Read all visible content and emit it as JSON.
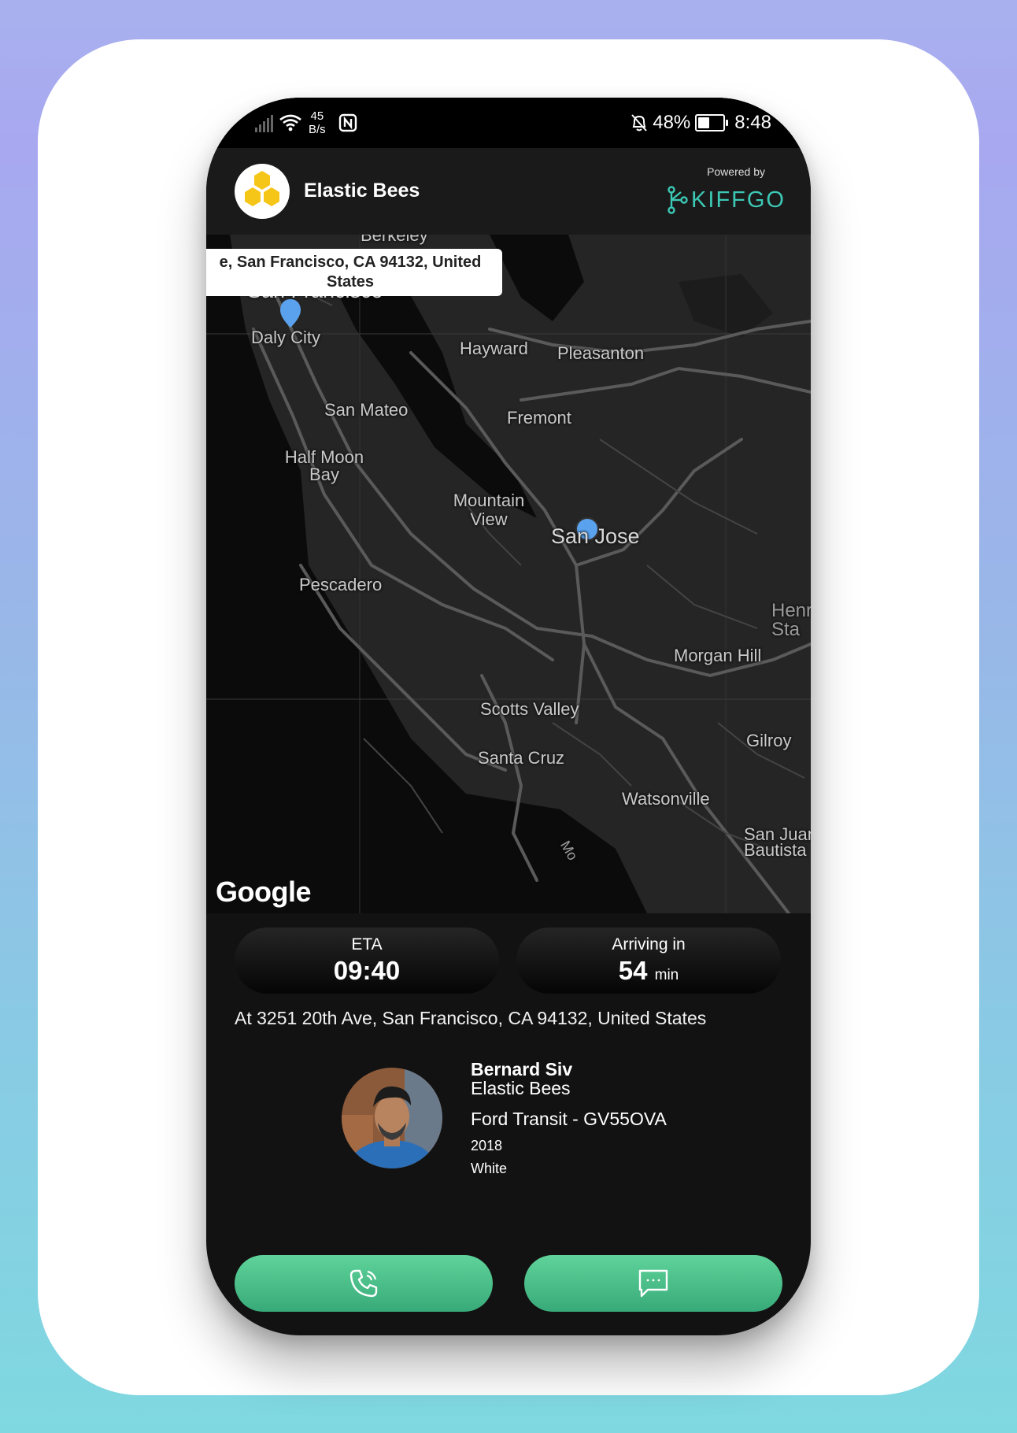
{
  "status_bar": {
    "speed_value": "45",
    "speed_unit": "B/s",
    "battery": "48%",
    "time": "8:48"
  },
  "header": {
    "company_name": "Elastic Bees",
    "powered_by": "Powered by",
    "partner_name": "KIFFGO"
  },
  "map": {
    "popup_line1": "e, San Francisco, CA 94132, United",
    "popup_line2": "States",
    "attribution": "Google",
    "places": {
      "berkeley": "Berkeley",
      "san_francisco": "San Francisco",
      "daly_city": "Daly City",
      "hayward": "Hayward",
      "pleasanton": "Pleasanton",
      "san_mateo": "San Mateo",
      "fremont": "Fremont",
      "half_moon_bay": "Half Moon Bay",
      "mountain_view": "Mountain View",
      "san_jose": "San Jose",
      "pescadero": "Pescadero",
      "henry_stark": "Henr Sta",
      "morgan_hill": "Morgan Hill",
      "scotts_valley": "Scotts Valley",
      "gilroy": "Gilroy",
      "santa_cruz": "Santa Cruz",
      "watsonville": "Watsonville",
      "san_juan": "San Juan Bautista",
      "monterey_bay": "Mo"
    }
  },
  "eta": {
    "label": "ETA",
    "value": "09:40"
  },
  "arriving": {
    "label": "Arriving in",
    "value": "54",
    "unit": "min"
  },
  "destination": "At 3251 20th Ave, San Francisco, CA 94132, United States",
  "driver": {
    "name": "Bernard Siv",
    "company": "Elastic Bees",
    "vehicle": "Ford Transit - GV55OVA",
    "year": "2018",
    "color": "White"
  },
  "actions": {
    "call_icon": "phone-icon",
    "message_icon": "chat-icon"
  },
  "colors": {
    "accent_green": "#4cc48c",
    "map_marker": "#5aa2ee",
    "brand_teal": "#3cc8b4",
    "honeycomb_yellow": "#f5c518"
  }
}
